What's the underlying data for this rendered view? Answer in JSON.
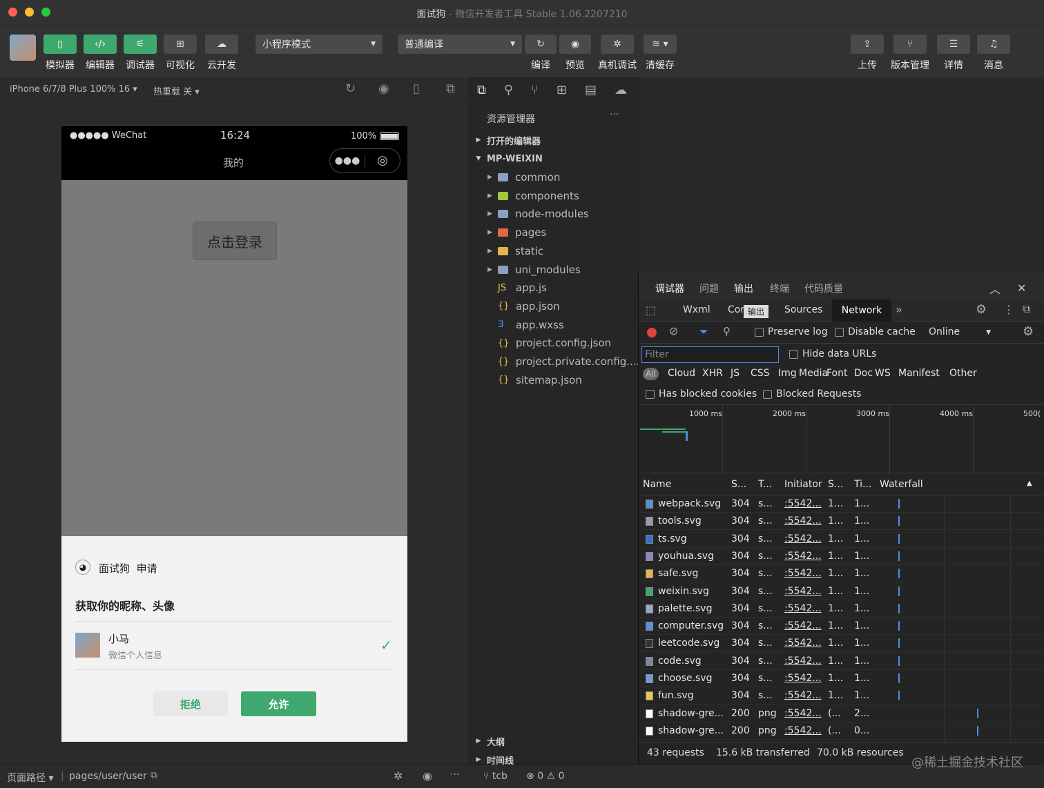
{
  "window": {
    "title": "面试狗",
    "subtitle": "- 微信开发者工具 Stable 1.06.2207210"
  },
  "toolbar": {
    "left_buttons": [
      "模拟器",
      "编辑器",
      "调试器",
      "可视化",
      "云开发"
    ],
    "mode_select": "小程序模式",
    "compile_select": "普通编译",
    "mid_buttons": [
      "编译",
      "预览",
      "真机调试",
      "清缓存"
    ],
    "right_buttons": [
      "上传",
      "版本管理",
      "详情",
      "消息"
    ]
  },
  "simulator": {
    "device": "iPhone 6/7/8 Plus 100% 16",
    "hot_reload": "热重载 关",
    "status_carrier": "●●●●● WeChat",
    "status_time": "16:24",
    "status_battery": "100%",
    "nav_title": "我的",
    "login_button": "点击登录",
    "auth": {
      "app_name": "面试狗",
      "apply": "申请",
      "request": "获取你的昵称、头像",
      "user_name": "小马",
      "user_desc": "微信个人信息",
      "reject": "拒绝",
      "allow": "允许"
    }
  },
  "explorer": {
    "title": "资源管理器",
    "more": "···",
    "open_editors": "打开的编辑器",
    "project": "MP-WEIXIN",
    "items": [
      {
        "name": "common",
        "type": "folder",
        "color": "#8aa0c0"
      },
      {
        "name": "components",
        "type": "folder",
        "color": "#a4c639"
      },
      {
        "name": "node-modules",
        "type": "folder",
        "color": "#8aa0c0"
      },
      {
        "name": "pages",
        "type": "folder",
        "color": "#e0674a"
      },
      {
        "name": "static",
        "type": "folder",
        "color": "#e6b44c"
      },
      {
        "name": "uni_modules",
        "type": "folder",
        "color": "#8aa0c0"
      },
      {
        "name": "app.js",
        "type": "js",
        "color": "#e6c84c"
      },
      {
        "name": "app.json",
        "type": "json",
        "color": "#e6c84c"
      },
      {
        "name": "app.wxss",
        "type": "wxss",
        "color": "#4a8fe6"
      },
      {
        "name": "project.config.json",
        "type": "json",
        "color": "#e6c84c"
      },
      {
        "name": "project.private.config....",
        "type": "json",
        "color": "#e6c84c"
      },
      {
        "name": "sitemap.json",
        "type": "json",
        "color": "#e6c84c"
      }
    ],
    "outline": "大纲",
    "timeline": "时间线"
  },
  "devtools": {
    "top_tabs": [
      "调试器",
      "问题",
      "输出",
      "终端",
      "代码质量"
    ],
    "panel_tabs": [
      "Wxml",
      "Cor",
      "Sources",
      "Network"
    ],
    "tooltip": "输出",
    "preserve_log": "Preserve log",
    "disable_cache": "Disable cache",
    "throttle": "Online",
    "filter_placeholder": "Filter",
    "hide_data_urls": "Hide data URLs",
    "type_filters": [
      "All",
      "Cloud",
      "XHR",
      "JS",
      "CSS",
      "Img",
      "Media",
      "Font",
      "Doc",
      "WS",
      "Manifest",
      "Other"
    ],
    "has_blocked_cookies": "Has blocked cookies",
    "blocked_requests": "Blocked Requests",
    "timeline_ticks": [
      "1000 ms",
      "2000 ms",
      "3000 ms",
      "4000 ms",
      "500("
    ],
    "columns": [
      "Name",
      "S...",
      "T...",
      "Initiator",
      "S...",
      "Ti...",
      "Waterfall"
    ],
    "rows": [
      {
        "name": "webpack.svg",
        "status": "304",
        "type": "s...",
        "initiator": ":5542...",
        "size": "1...",
        "time": "1...",
        "icon": "#5b8fd6"
      },
      {
        "name": "tools.svg",
        "status": "304",
        "type": "s...",
        "initiator": ":5542...",
        "size": "1...",
        "time": "1...",
        "icon": "#9a9ab0"
      },
      {
        "name": "ts.svg",
        "status": "304",
        "type": "s...",
        "initiator": ":5542...",
        "size": "1...",
        "time": "1...",
        "icon": "#3a6fd0"
      },
      {
        "name": "youhua.svg",
        "status": "304",
        "type": "s...",
        "initiator": ":5542...",
        "size": "1...",
        "time": "1...",
        "icon": "#8a8ab8"
      },
      {
        "name": "safe.svg",
        "status": "304",
        "type": "s...",
        "initiator": ":5542...",
        "size": "1...",
        "time": "1...",
        "icon": "#e6b44c"
      },
      {
        "name": "weixin.svg",
        "status": "304",
        "type": "s...",
        "initiator": ":5542...",
        "size": "1...",
        "time": "1...",
        "icon": "#3ea86f"
      },
      {
        "name": "palette.svg",
        "status": "304",
        "type": "s...",
        "initiator": ":5542...",
        "size": "1...",
        "time": "1...",
        "icon": "#9aa6d0"
      },
      {
        "name": "computer.svg",
        "status": "304",
        "type": "s...",
        "initiator": ":5542...",
        "size": "1...",
        "time": "1...",
        "icon": "#5b8fd6"
      },
      {
        "name": "leetcode.svg",
        "status": "304",
        "type": "s...",
        "initiator": ":5542...",
        "size": "1...",
        "time": "1...",
        "icon": "#333333"
      },
      {
        "name": "code.svg",
        "status": "304",
        "type": "s...",
        "initiator": ":5542...",
        "size": "1...",
        "time": "1...",
        "icon": "#7a8aa0"
      },
      {
        "name": "choose.svg",
        "status": "304",
        "type": "s...",
        "initiator": ":5542...",
        "size": "1...",
        "time": "1...",
        "icon": "#6aa0d6"
      },
      {
        "name": "fun.svg",
        "status": "304",
        "type": "s...",
        "initiator": ":5542...",
        "size": "1...",
        "time": "1...",
        "icon": "#e6c84c"
      },
      {
        "name": "shadow-gre...",
        "status": "200",
        "type": "png",
        "initiator": ":5542...",
        "size": "(...",
        "time": "2...",
        "icon": "#ffffff"
      },
      {
        "name": "shadow-gre...",
        "status": "200",
        "type": "png",
        "initiator": ":5542...",
        "size": "(...",
        "time": "0...",
        "icon": "#ffffff"
      }
    ],
    "summary": [
      "43 requests",
      "15.6 kB transferred",
      "70.0 kB resources"
    ]
  },
  "bottombar": {
    "path_label": "页面路径",
    "path": "pages/user/user",
    "branch": "tcb",
    "errors": "0",
    "warnings": "0"
  },
  "watermark": "@稀土掘金技术社区"
}
